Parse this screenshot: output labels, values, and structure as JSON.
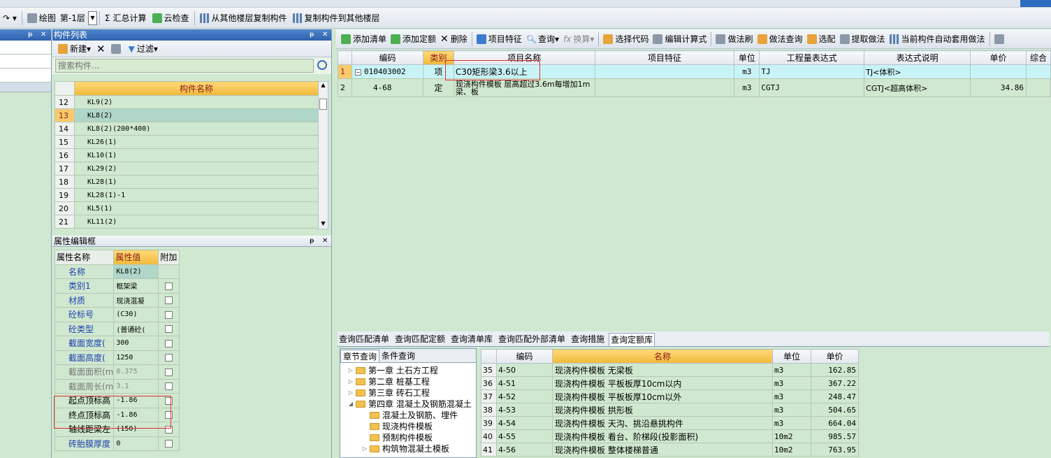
{
  "toolbar": {
    "draw_label": "绘图",
    "floor_value": "第-1层",
    "sum_label": "汇总计算",
    "cloud_check_label": "云检查",
    "copy_from_label": "从其他楼层复制构件",
    "copy_to_label": "复制构件到其他楼层"
  },
  "complist": {
    "title": "构件列表",
    "new_label": "新建",
    "filter_label": "过滤",
    "search_placeholder": "搜索构件...",
    "col_name": "构件名称",
    "rows": [
      {
        "num": "12",
        "name": "KL9(2)"
      },
      {
        "num": "13",
        "name": "KL8(2)"
      },
      {
        "num": "14",
        "name": "KL8(2)(200*400)"
      },
      {
        "num": "15",
        "name": "KL26(1)"
      },
      {
        "num": "16",
        "name": "KL10(1)"
      },
      {
        "num": "17",
        "name": "KL29(2)"
      },
      {
        "num": "18",
        "name": "KL28(1)"
      },
      {
        "num": "19",
        "name": "KL28(1)-1"
      },
      {
        "num": "20",
        "name": "KL5(1)"
      },
      {
        "num": "21",
        "name": "KL11(2)"
      }
    ]
  },
  "propedit": {
    "title": "属性编辑框",
    "col_name": "属性名称",
    "col_value": "属性值",
    "col_extra": "附加",
    "rows": [
      {
        "name": "名称",
        "value": "KL8(2)"
      },
      {
        "name": "类别1",
        "value": "框架梁"
      },
      {
        "name": "材质",
        "value": "现浇混凝"
      },
      {
        "name": "砼标号",
        "value": "(C30)"
      },
      {
        "name": "砼类型",
        "value": "(普通砼("
      },
      {
        "name": "截面宽度(",
        "value": "300"
      },
      {
        "name": "截面高度(",
        "value": "1250"
      },
      {
        "name": "截面面积(m",
        "value": "0.375"
      },
      {
        "name": "截面周长(m",
        "value": "3.1"
      },
      {
        "name": "起点顶标高",
        "value": "-1.86"
      },
      {
        "name": "终点顶标高",
        "value": "-1.86"
      },
      {
        "name": "轴线距梁左",
        "value": "(150)"
      },
      {
        "name": "砖胎膜厚度",
        "value": "0"
      }
    ]
  },
  "rtoolbar": {
    "add_list": "添加清单",
    "add_quota": "添加定额",
    "delete": "删除",
    "item_feature": "项目特征",
    "query": "查询",
    "convert": "换算",
    "select_code": "选择代码",
    "edit_formula": "编辑计算式",
    "method_brush": "做法刷",
    "method_query": "做法查询",
    "select_match": "选配",
    "extract_method": "提取做法",
    "auto_apply": "当前构件自动套用做法"
  },
  "main_table": {
    "headers": [
      "编码",
      "类别",
      "项目名称",
      "项目特征",
      "单位",
      "工程量表达式",
      "表达式说明",
      "单价",
      "综合"
    ],
    "rows": [
      {
        "idx": "1",
        "code": "010403002",
        "type": "项",
        "name": "C30矩形梁3.6以上",
        "feature": "",
        "unit": "m3",
        "expr": "TJ",
        "desc": "TJ<体积>",
        "price": ""
      },
      {
        "idx": "2",
        "code": "4-68",
        "type": "定",
        "name": "现浇构件模板 层高超过3.6m每增加1m梁、板",
        "feature": "",
        "unit": "m3",
        "expr": "CGTJ",
        "desc": "CGTJ<超高体积>",
        "price": "34.86"
      }
    ]
  },
  "bottom_tabs": [
    "查询匹配清单",
    "查询匹配定额",
    "查询清单库",
    "查询匹配外部清单",
    "查询措施",
    "查询定额库"
  ],
  "tree": {
    "tabs": [
      "章节查询",
      "条件查询"
    ],
    "items": [
      {
        "label": "第一章 土石方工程"
      },
      {
        "label": "第二章 桩基工程"
      },
      {
        "label": "第三章 砖石工程"
      },
      {
        "label": "第四章 混凝土及钢筋混凝土"
      },
      {
        "label": "混凝土及钢筋、埋件"
      },
      {
        "label": "现浇构件模板"
      },
      {
        "label": "预制构件模板"
      },
      {
        "label": "构筑物混凝土模板"
      }
    ]
  },
  "quota_table": {
    "headers": [
      "编码",
      "名称",
      "单位",
      "单价"
    ],
    "rows": [
      {
        "idx": "35",
        "code": "4-50",
        "name": "现浇构件模板 无梁板",
        "unit": "m3",
        "price": "162.85"
      },
      {
        "idx": "36",
        "code": "4-51",
        "name": "现浇构件模板 平板板厚10cm以内",
        "unit": "m3",
        "price": "367.22"
      },
      {
        "idx": "37",
        "code": "4-52",
        "name": "现浇构件模板 平板板厚10cm以外",
        "unit": "m3",
        "price": "248.47"
      },
      {
        "idx": "38",
        "code": "4-53",
        "name": "现浇构件模板 拱形板",
        "unit": "m3",
        "price": "504.65"
      },
      {
        "idx": "39",
        "code": "4-54",
        "name": "现浇构件模板 天沟、挑沿悬挑构件",
        "unit": "m3",
        "price": "664.04"
      },
      {
        "idx": "40",
        "code": "4-55",
        "name": "现浇构件模板 看台、阶梯段(投影面积)",
        "unit": "10m2",
        "price": "985.57"
      },
      {
        "idx": "41",
        "code": "4-56",
        "name": "现浇构件模板 整体楼梯普通",
        "unit": "10m2",
        "price": "763.95"
      }
    ]
  }
}
